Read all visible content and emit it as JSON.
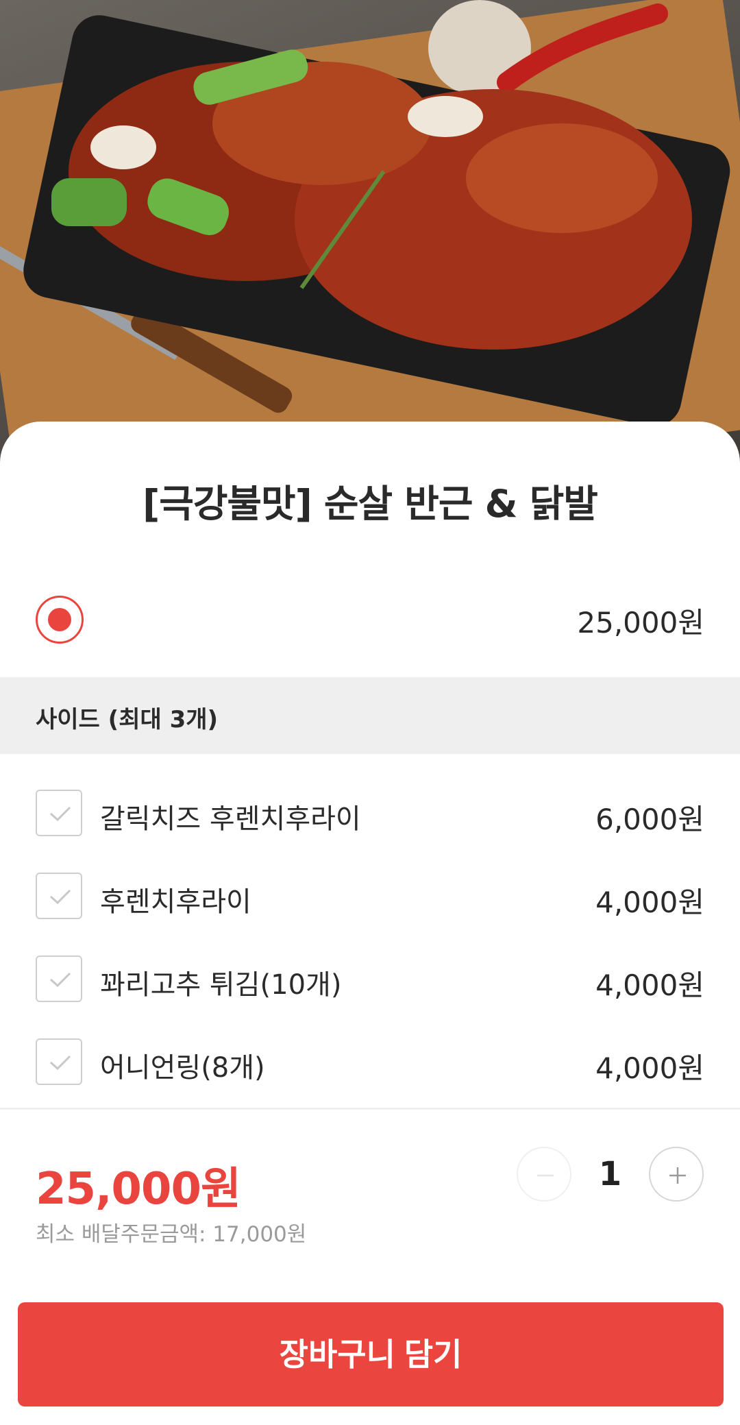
{
  "product": {
    "title": "[극강불맛] 순살 반근 & 닭발",
    "image_alt": "grilled spicy chicken and chicken feet on a black tray",
    "base_price": "25,000원"
  },
  "side_section": {
    "header": "사이드 (최대 3개)",
    "options": [
      {
        "label": "갈릭치즈 후렌치후라이",
        "price": "6,000원",
        "checked": false
      },
      {
        "label": "후렌치후라이",
        "price": "4,000원",
        "checked": false
      },
      {
        "label": "꽈리고추 튀김(10개)",
        "price": "4,000원",
        "checked": false
      },
      {
        "label": "어니언링(8개)",
        "price": "4,000원",
        "checked": false
      }
    ]
  },
  "summary": {
    "total": "25,000원",
    "min_order": "최소 배달주문금액: 17,000원",
    "quantity": "1"
  },
  "cart_button": {
    "label": "장바구니 담기"
  },
  "colors": {
    "accent": "#ea463f",
    "section_bg": "#efefef",
    "muted_text": "#9a9a9a"
  },
  "icons": {
    "minus": "minus-icon",
    "plus": "plus-icon",
    "check": "check-icon"
  }
}
